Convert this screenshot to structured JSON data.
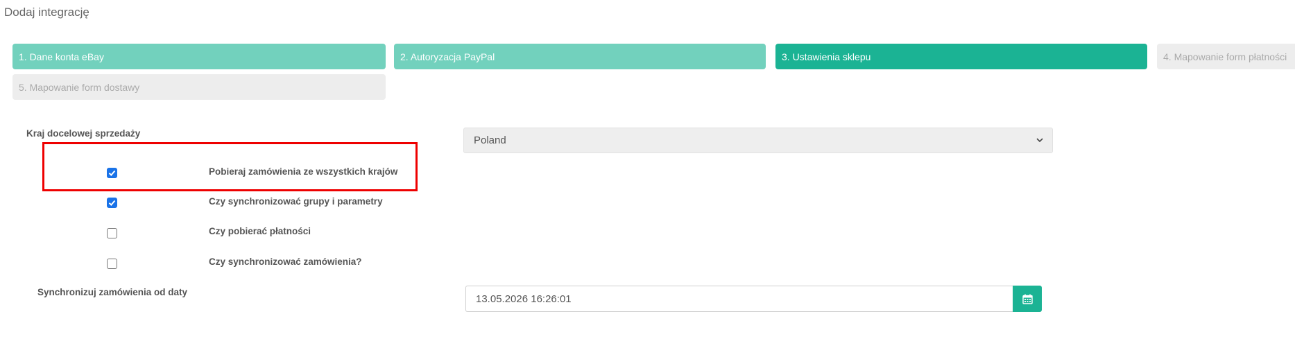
{
  "page": {
    "title": "Dodaj integrację"
  },
  "steps": [
    {
      "label": "1. Dane konta eBay",
      "state": "done"
    },
    {
      "label": "2. Autoryzacja PayPal",
      "state": "done"
    },
    {
      "label": "3. Ustawienia sklepu",
      "state": "active"
    },
    {
      "label": "4. Mapowanie form płatności",
      "state": "todo"
    },
    {
      "label": "5. Mapowanie form dostawy",
      "state": "todo"
    }
  ],
  "country": {
    "label": "Kraj docelowej sprzedaży",
    "selected": "Poland"
  },
  "options": [
    {
      "label": "Pobieraj zamówienia ze wszystkich krajów",
      "checked": true
    },
    {
      "label": "Czy synchronizować grupy i parametry",
      "checked": true
    },
    {
      "label": "Czy pobierać płatności",
      "checked": false
    },
    {
      "label": "Czy synchronizować zamówienia?",
      "checked": false
    }
  ],
  "sync_date": {
    "label": "Synchronizuj zamówienia od daty",
    "value": "13.05.2026 16:26:01"
  },
  "colors": {
    "step_done": "#72d1bd",
    "step_active": "#1bb394",
    "step_todo": "#ededed",
    "checkbox_on": "#1a73e8",
    "highlight": "#ee0000"
  },
  "icons": {
    "select_chevron": "chevron-down-icon",
    "check": "check-icon",
    "calendar": "calendar-icon"
  }
}
